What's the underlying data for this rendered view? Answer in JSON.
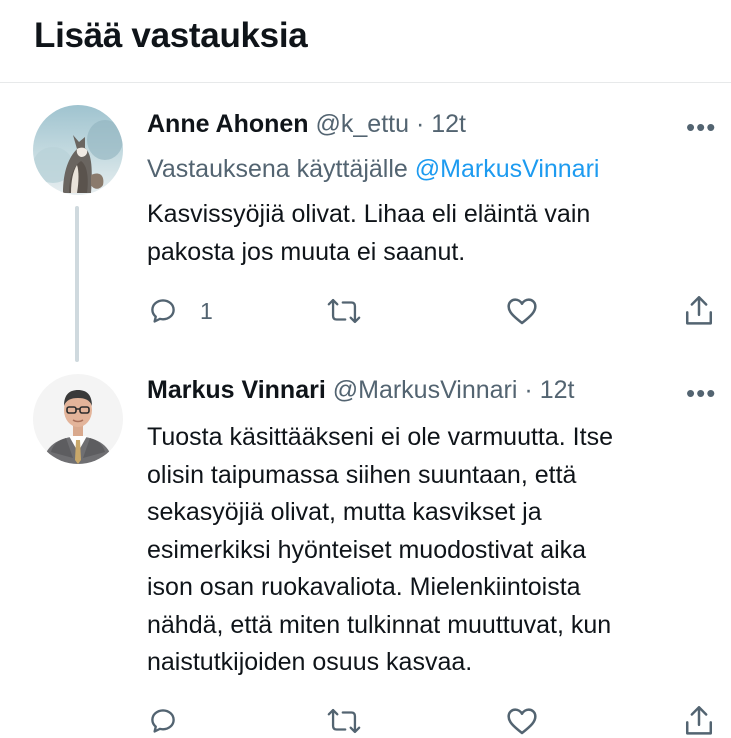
{
  "header": {
    "title": "Lisää vastauksia"
  },
  "tweets": [
    {
      "name": "Anne Ahonen",
      "handle": "@k_ettu",
      "separator": "·",
      "time": "12t",
      "replying_prefix": "Vastauksena käyttäjälle",
      "replying_to": "@MarkusVinnari",
      "text": "Kasvissyöjiä olivat. Lihaa eli eläintä vain\npakosta jos muuta ei saanut.",
      "reply_count": "1",
      "avatar_icon": "fox-photo-icon"
    },
    {
      "name": "Markus Vinnari",
      "handle": "@MarkusVinnari",
      "separator": "·",
      "time": "12t",
      "text": "Tuosta käsittääkseni ei ole varmuutta. Itse\nolisin taipumassa siihen suuntaan, että\nsekasyöjiä olivat, mutta kasvikset ja\nesimerkiksi hyönteiset muodostivat aika\nison osan ruokavaliota. Mielenkiintoista\nnähdä, että miten tulkinnat muuttuvat, kun\nnaistutkijoiden osuus kasvaa.",
      "avatar_icon": "man-portrait-icon"
    }
  ],
  "more_label": "•••",
  "colors": {
    "text": "#0f1419",
    "secondary": "#536471",
    "link": "#1d9bf0",
    "divider": "#e7e9ea"
  }
}
